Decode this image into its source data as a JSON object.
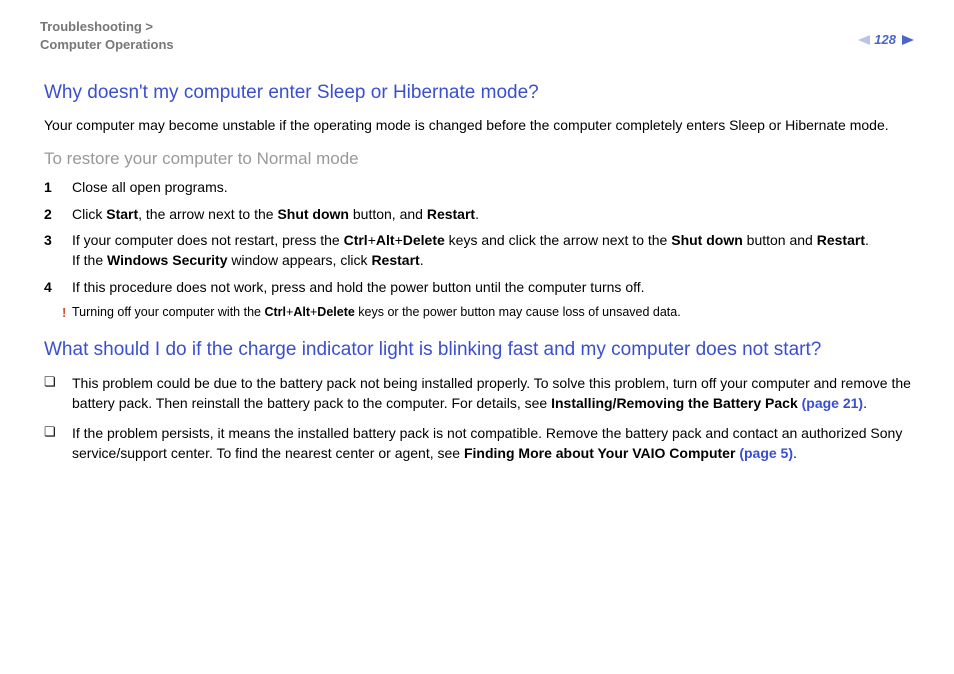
{
  "header": {
    "breadcrumb_line1": "Troubleshooting >",
    "breadcrumb_line2": "Computer Operations",
    "page_number": "128"
  },
  "section1": {
    "heading": "Why doesn't my computer enter Sleep or Hibernate mode?",
    "lead": "Your computer may become unstable if the operating mode is changed before the computer completely enters Sleep or Hibernate mode.",
    "subheading": "To restore your computer to Normal mode",
    "steps": {
      "s1": {
        "num": "1",
        "text": "Close all open programs."
      },
      "s2": {
        "num": "2",
        "t1": "Click ",
        "b1": "Start",
        "t2": ", the arrow next to the ",
        "b2": "Shut down",
        "t3": " button, and ",
        "b3": "Restart",
        "t4": "."
      },
      "s3": {
        "num": "3",
        "t1": "If your computer does not restart, press the ",
        "b1": "Ctrl",
        "p1": "+",
        "b2": "Alt",
        "p2": "+",
        "b3": "Delete",
        "t2": " keys and click the arrow next to the ",
        "b4": "Shut down",
        "t3": " button and ",
        "b5": "Restart",
        "t4": ".",
        "line2a": "If the ",
        "line2b": "Windows Security",
        "line2c": " window appears, click ",
        "line2d": "Restart",
        "line2e": "."
      },
      "s4": {
        "num": "4",
        "text": "If this procedure does not work, press and hold the power button until the computer turns off."
      }
    },
    "caution": {
      "bang": "!",
      "t1": "Turning off your computer with the ",
      "b1": "Ctrl",
      "p1": "+",
      "b2": "Alt",
      "p2": "+",
      "b3": "Delete",
      "t2": " keys or the power button may cause loss of unsaved data."
    }
  },
  "section2": {
    "heading": "What should I do if the charge indicator light is blinking fast and my computer does not start?",
    "bullets": {
      "b1": {
        "t1": "This problem could be due to the battery pack not being installed properly. To solve this problem, turn off your computer and remove the battery pack. Then reinstall the battery pack to the computer. For details, see ",
        "bref": "Installing/Removing the Battery Pack ",
        "link": "(page 21)",
        "t2": "."
      },
      "b2": {
        "t1": "If the problem persists, it means the installed battery pack is not compatible. Remove the battery pack and contact an authorized Sony service/support center. To find the nearest center or agent, see ",
        "bref": "Finding More about Your VAIO Computer ",
        "link": "(page 5)",
        "t2": "."
      }
    }
  }
}
